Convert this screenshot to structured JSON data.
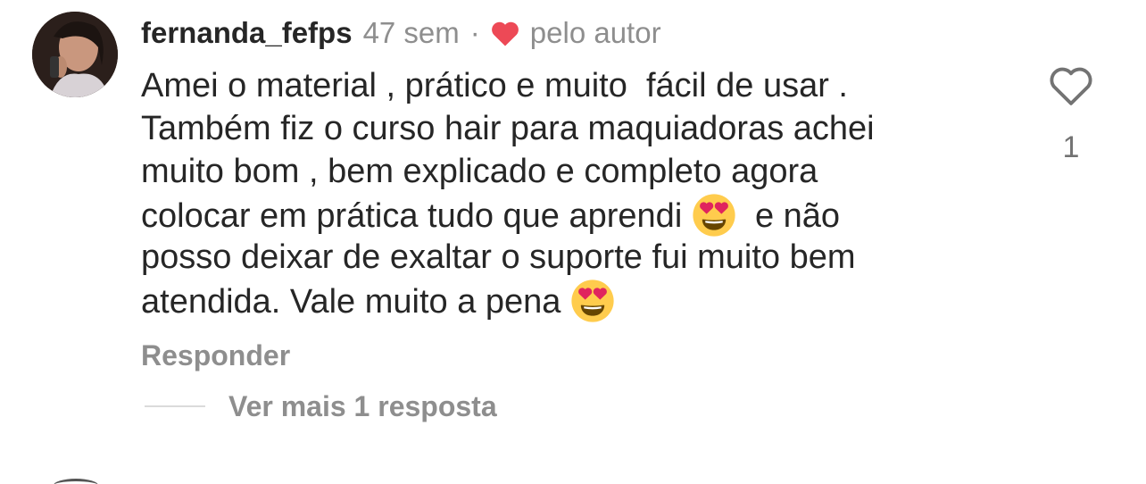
{
  "comment": {
    "username": "fernanda_fefps",
    "time": "47 sem",
    "separator": "·",
    "author_like_label": "pelo autor",
    "body_lines": [
      "Amei o material , prático e muito  fácil de usar .",
      "Também fiz o curso hair para maquiadoras achei",
      "muito bom , bem explicado e completo agora",
      "colocar em prática tudo que aprendi",
      "e não",
      "posso deixar de exaltar o suporte fui muito bem",
      "atendida. Vale muito a pena"
    ],
    "emojis": [
      "heart-eyes",
      "heart-eyes"
    ],
    "reply_label": "Responder",
    "view_replies_label": "Ver mais 1 resposta",
    "like_count": "1"
  },
  "colors": {
    "text_primary": "#262626",
    "text_secondary": "#8e8e8e",
    "heart_red": "#ed4956",
    "emoji_yellow": "#ffcc4d"
  },
  "icons": {
    "author_like": "heart-filled-icon",
    "like": "heart-outline-icon",
    "emoji": "heart-eyes-emoji-icon"
  }
}
